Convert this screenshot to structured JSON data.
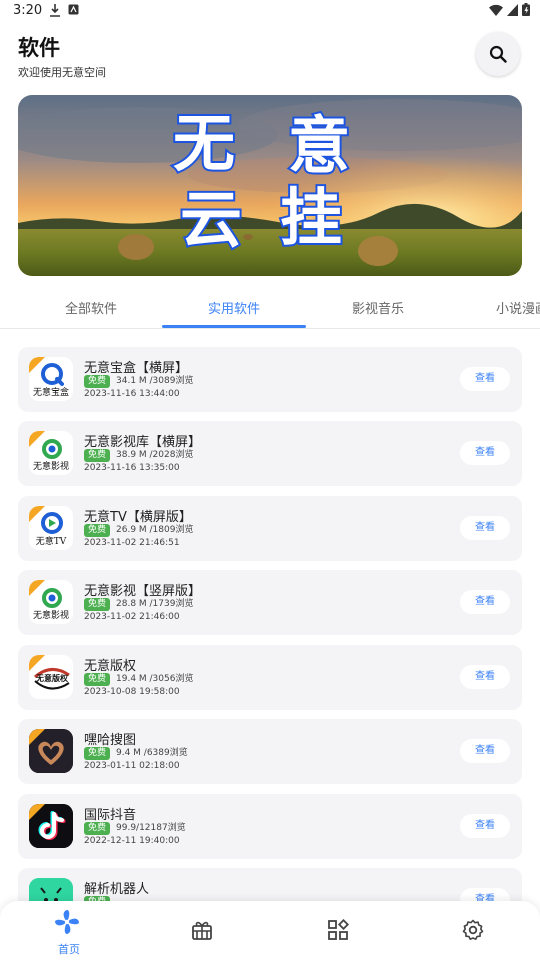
{
  "status_bar": {
    "time": "3:20"
  },
  "header": {
    "title": "软件",
    "subtitle": "欢迎使用无意空间"
  },
  "banner": {
    "line1": [
      "无",
      "意"
    ],
    "line2": [
      "云",
      "挂"
    ]
  },
  "tabs": [
    {
      "label": "全部软件",
      "active": false
    },
    {
      "label": "实用软件",
      "active": true
    },
    {
      "label": "影视音乐",
      "active": false
    },
    {
      "label": "小说漫画",
      "active": false
    }
  ],
  "apps": [
    {
      "name": "无意宝盒【横屏】",
      "badge": "免费",
      "meta": "34.1 M /3089浏览",
      "date": "2023-11-16 13:44:00",
      "button": "查看",
      "icon_text": "无意宝盒"
    },
    {
      "name": "无意影视库【横屏】",
      "badge": "免费",
      "meta": "38.9 M /2028浏览",
      "date": "2023-11-16 13:35:00",
      "button": "查看",
      "icon_text": "无意影视"
    },
    {
      "name": "无意TV【横屏版】",
      "badge": "免费",
      "meta": "26.9 M /1809浏览",
      "date": "2023-11-02 21:46:51",
      "button": "查看",
      "icon_text": "无意TV"
    },
    {
      "name": "无意影视【竖屏版】",
      "badge": "免费",
      "meta": "28.8 M /1739浏览",
      "date": "2023-11-02 21:46:00",
      "button": "查看",
      "icon_text": "无意影视"
    },
    {
      "name": "无意版权",
      "badge": "免费",
      "meta": "19.4 M /3056浏览",
      "date": "2023-10-08 19:58:00",
      "button": "查看",
      "icon_text": "无意版权"
    },
    {
      "name": "嘿哈搜图",
      "badge": "免费",
      "meta": "9.4 M /6389浏览",
      "date": "2023-01-11 02:18:00",
      "button": "查看",
      "icon_text": ""
    },
    {
      "name": "国际抖音",
      "badge": "免费",
      "meta": "99.9/12187浏览",
      "date": "2022-12-11 19:40:00",
      "button": "查看",
      "icon_text": ""
    },
    {
      "name": "解析机器人",
      "badge": "免费",
      "meta": "",
      "date": "",
      "button": "查看",
      "icon_text": ""
    }
  ],
  "bottom_nav": {
    "home_label": "首页"
  },
  "colors": {
    "accent": "#3b82f6",
    "badge_green": "#4cb050",
    "card_bg": "#f4f4f6"
  }
}
